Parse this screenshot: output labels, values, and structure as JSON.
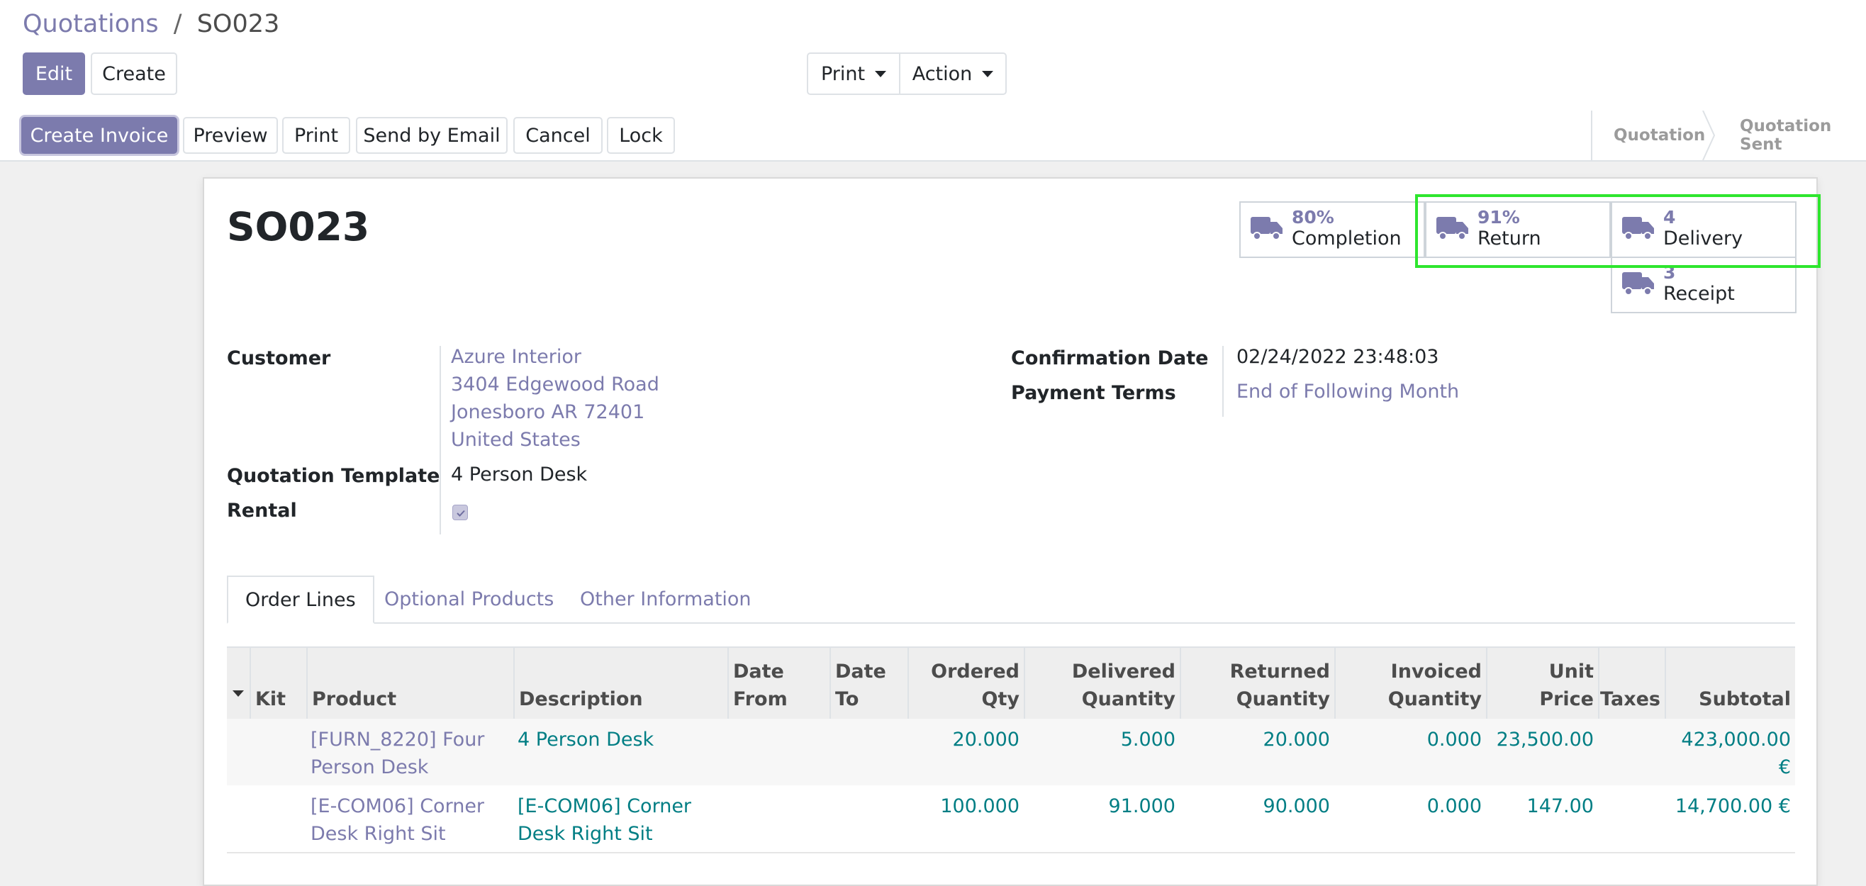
{
  "breadcrumb": {
    "parent": "Quotations",
    "separator": "/",
    "current": "SO023"
  },
  "toolbar": {
    "edit": "Edit",
    "create": "Create",
    "print": "Print",
    "action": "Action"
  },
  "statusbar": {
    "buttons": [
      "Create Invoice",
      "Preview",
      "Print",
      "Send by Email",
      "Cancel",
      "Lock"
    ],
    "stages": [
      "Quotation",
      "Quotation Sent"
    ]
  },
  "record": {
    "title": "SO023",
    "smart_buttons": [
      {
        "value": "80%",
        "label": "Completion",
        "icon": "truck-icon"
      },
      {
        "value": "91%",
        "label": "Return",
        "icon": "truck-icon"
      },
      {
        "value": "4",
        "label": "Delivery",
        "icon": "truck-icon"
      },
      {
        "value": "3",
        "label": "Receipt",
        "icon": "truck-icon"
      }
    ],
    "fields": {
      "customer_label": "Customer",
      "customer_lines": [
        "Azure Interior",
        "3404 Edgewood Road",
        "Jonesboro AR 72401",
        "United States"
      ],
      "template_label": "Quotation Template",
      "template_value": "4 Person Desk",
      "rental_label": "Rental",
      "rental_checked": true,
      "confirmation_label": "Confirmation Date",
      "confirmation_value": "02/24/2022 23:48:03",
      "payment_label": "Payment Terms",
      "payment_value": "End of Following Month"
    }
  },
  "tabs": [
    "Order Lines",
    "Optional Products",
    "Other Information"
  ],
  "order_lines": {
    "headers": [
      "Kit",
      "Product",
      "Description",
      "Date From",
      "Date To",
      "Ordered Qty",
      "Delivered Quantity",
      "Returned Quantity",
      "Invoiced Quantity",
      "Unit Price",
      "Taxes",
      "Subtotal"
    ],
    "rows": [
      {
        "product": "[FURN_8220] Four Person Desk",
        "description": "4 Person Desk",
        "ordered": "20.000",
        "delivered": "5.000",
        "returned": "20.000",
        "invoiced": "0.000",
        "unit_price": "23,500.00",
        "subtotal": "423,000.00 €"
      },
      {
        "product": "[E-COM06] Corner Desk Right Sit",
        "description": "[E-COM06] Corner Desk Right Sit",
        "ordered": "100.000",
        "delivered": "91.000",
        "returned": "90.000",
        "invoiced": "0.000",
        "unit_price": "147.00",
        "subtotal": "14,700.00 €"
      }
    ]
  },
  "colors": {
    "brand": "#7c7bad",
    "link_teal": "#017e84",
    "highlight": "#2ee62e"
  }
}
